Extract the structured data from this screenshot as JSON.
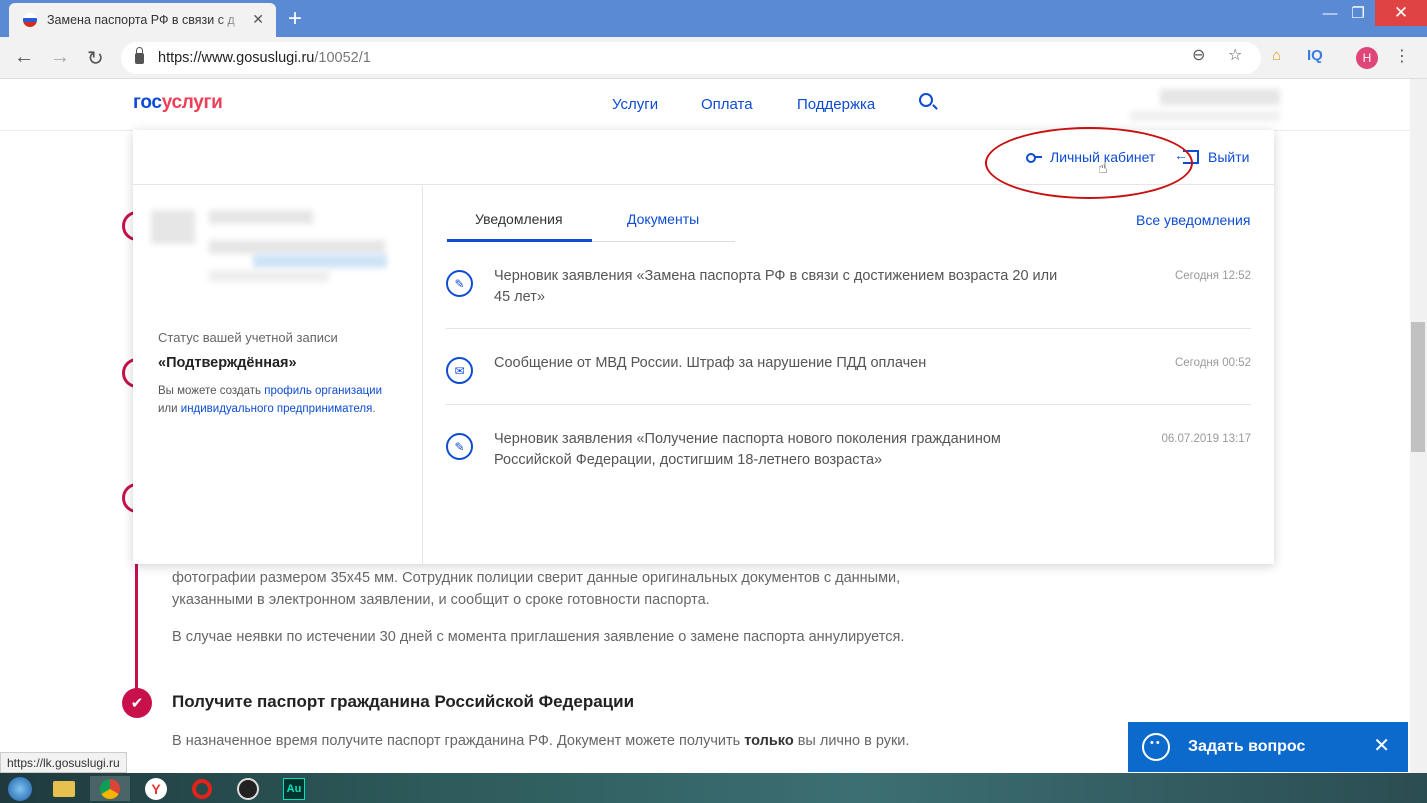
{
  "browser": {
    "tab_title": "Замена паспорта РФ в связи с д",
    "url_host": "https://www.gosuslugi.ru",
    "url_path": "/10052/1",
    "avatar_letter": "Н",
    "ext_iq": "IQ",
    "status_url": "https://lk.gosuslugi.ru"
  },
  "site": {
    "logo_part1": "гос",
    "logo_part2": "услуги",
    "nav": [
      "Услуги",
      "Оплата",
      "Поддержка"
    ]
  },
  "panel": {
    "lk_label": "Личный кабинет",
    "exit_label": "Выйти",
    "status_label": "Статус вашей учетной записи",
    "status_value": "«Подтверждённая»",
    "note_prefix": "Вы можете создать ",
    "note_link1": "профиль организации",
    "note_mid": " или ",
    "note_link2": "индивидуального предпринимателя",
    "note_suffix": ".",
    "tabs": [
      "Уведомления",
      "Документы"
    ],
    "all_notifications": "Все уведомления",
    "notifications": [
      {
        "text": "Черновик заявления «Замена паспорта РФ в связи с достижением возраста 20 или 45 лет»",
        "time": "Сегодня 12:52",
        "icon": "draft-icon"
      },
      {
        "text": "Сообщение от МВД России. Штраф за нарушение ПДД оплачен",
        "time": "Сегодня 00:52",
        "icon": "message-icon"
      },
      {
        "text": "Черновик заявления «Получение паспорта нового поколения гражданином Российской Федерации, достигшим 18-летнего возраста»",
        "time": "06.07.2019 13:17",
        "icon": "draft-icon"
      }
    ]
  },
  "content": {
    "para1_line1": "фотографии размером 35х45 мм. Сотрудник полиции сверит данные оригинальных документов с данными,",
    "para1_line2": "указанными в электронном заявлении, и сообщит о сроке готовности паспорта.",
    "para2": "В случае неявки по истечении 30 дней с момента приглашения заявление о замене паспорта аннулируется.",
    "step_heading": "Получите паспорт гражданина Российской Федерации",
    "step_text_pre": "В назначенное время получите паспорт гражданина РФ. Документ можете получить ",
    "step_text_bold": "только",
    "step_text_post": " вы лично в руки."
  },
  "chat": {
    "label": "Задать вопрос"
  },
  "taskbar": {
    "au_label": "Au"
  },
  "colors": {
    "accent": "#0d4cd3",
    "brand_red": "#ee3f58",
    "timeline": "#c8104a",
    "chat_bg": "#0d6acd",
    "titlebar": "#5a8ad4"
  }
}
